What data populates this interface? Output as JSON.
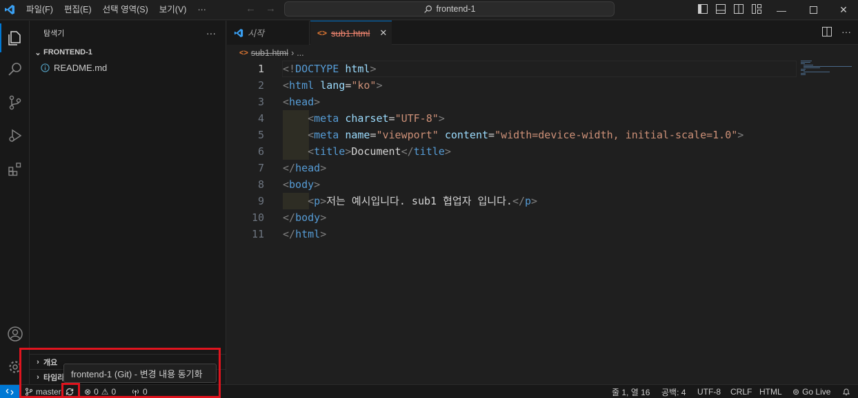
{
  "titlebar": {
    "menus": [
      "파일(F)",
      "편집(E)",
      "선택 영역(S)",
      "보기(V)",
      "···"
    ],
    "search_text": "frontend-1"
  },
  "sidebar": {
    "title": "탐색기",
    "more_label": "···",
    "folder": "FRONTEND-1",
    "files": [
      {
        "name": "README.md",
        "icon": "info-icon"
      }
    ],
    "bottom_sections": [
      "개요",
      "타임라인"
    ]
  },
  "tabs": [
    {
      "label": "시작",
      "active": false
    },
    {
      "label": "sub1.html",
      "active": true,
      "close": "✕"
    }
  ],
  "breadcrumb": {
    "file": "sub1.html",
    "sep": "›",
    "more": "..."
  },
  "editor": {
    "lines": [
      {
        "n": "1",
        "tokens": [
          [
            "br",
            "<!"
          ],
          [
            "tag",
            "DOCTYPE"
          ],
          [
            "txt",
            " "
          ],
          [
            "attr",
            "html"
          ],
          [
            "br",
            ">"
          ]
        ]
      },
      {
        "n": "2",
        "tokens": [
          [
            "br",
            "<"
          ],
          [
            "tag",
            "html"
          ],
          [
            "txt",
            " "
          ],
          [
            "attr",
            "lang"
          ],
          [
            "txt",
            "="
          ],
          [
            "str",
            "\"ko\""
          ],
          [
            "br",
            ">"
          ]
        ]
      },
      {
        "n": "3",
        "tokens": [
          [
            "br",
            "<"
          ],
          [
            "tag",
            "head"
          ],
          [
            "br",
            ">"
          ]
        ]
      },
      {
        "n": "4",
        "indent": true,
        "tokens": [
          [
            "txt",
            "    "
          ],
          [
            "br",
            "<"
          ],
          [
            "tag",
            "meta"
          ],
          [
            "txt",
            " "
          ],
          [
            "attr",
            "charset"
          ],
          [
            "txt",
            "="
          ],
          [
            "str",
            "\"UTF-8\""
          ],
          [
            "br",
            ">"
          ]
        ]
      },
      {
        "n": "5",
        "indent": true,
        "tokens": [
          [
            "txt",
            "    "
          ],
          [
            "br",
            "<"
          ],
          [
            "tag",
            "meta"
          ],
          [
            "txt",
            " "
          ],
          [
            "attr",
            "name"
          ],
          [
            "txt",
            "="
          ],
          [
            "str",
            "\"viewport\""
          ],
          [
            "txt",
            " "
          ],
          [
            "attr",
            "content"
          ],
          [
            "txt",
            "="
          ],
          [
            "str",
            "\"width=device-width, initial-scale=1.0\""
          ],
          [
            "br",
            ">"
          ]
        ]
      },
      {
        "n": "6",
        "indent": true,
        "tokens": [
          [
            "txt",
            "    "
          ],
          [
            "br",
            "<"
          ],
          [
            "tag",
            "title"
          ],
          [
            "br",
            ">"
          ],
          [
            "txt",
            "Document"
          ],
          [
            "br",
            "</"
          ],
          [
            "tag",
            "title"
          ],
          [
            "br",
            ">"
          ]
        ]
      },
      {
        "n": "7",
        "tokens": [
          [
            "br",
            "</"
          ],
          [
            "tag",
            "head"
          ],
          [
            "br",
            ">"
          ]
        ]
      },
      {
        "n": "8",
        "tokens": [
          [
            "br",
            "<"
          ],
          [
            "tag",
            "body"
          ],
          [
            "br",
            ">"
          ]
        ]
      },
      {
        "n": "9",
        "indent": true,
        "tokens": [
          [
            "txt",
            "    "
          ],
          [
            "br",
            "<"
          ],
          [
            "tag",
            "p"
          ],
          [
            "br",
            ">"
          ],
          [
            "txt",
            "저는 예시입니다. sub1 협업자 입니다."
          ],
          [
            "br",
            "</"
          ],
          [
            "tag",
            "p"
          ],
          [
            "br",
            ">"
          ]
        ]
      },
      {
        "n": "10",
        "tokens": [
          [
            "br",
            "</"
          ],
          [
            "tag",
            "body"
          ],
          [
            "br",
            ">"
          ]
        ]
      },
      {
        "n": "11",
        "tokens": [
          [
            "br",
            "</"
          ],
          [
            "tag",
            "html"
          ],
          [
            "br",
            ">"
          ]
        ]
      }
    ]
  },
  "tooltip": "frontend-1 (Git) - 변경 내용 동기화",
  "statusbar": {
    "branch": "master",
    "errors": "0",
    "warnings": "0",
    "ports": "0",
    "position": "줄 1, 열 16",
    "spaces": "공백: 4",
    "encoding": "UTF-8",
    "eol": "CRLF",
    "language": "HTML",
    "golive": "Go Live"
  },
  "colors": {
    "accent": "#0078d4",
    "highlight": "#e0141e"
  }
}
